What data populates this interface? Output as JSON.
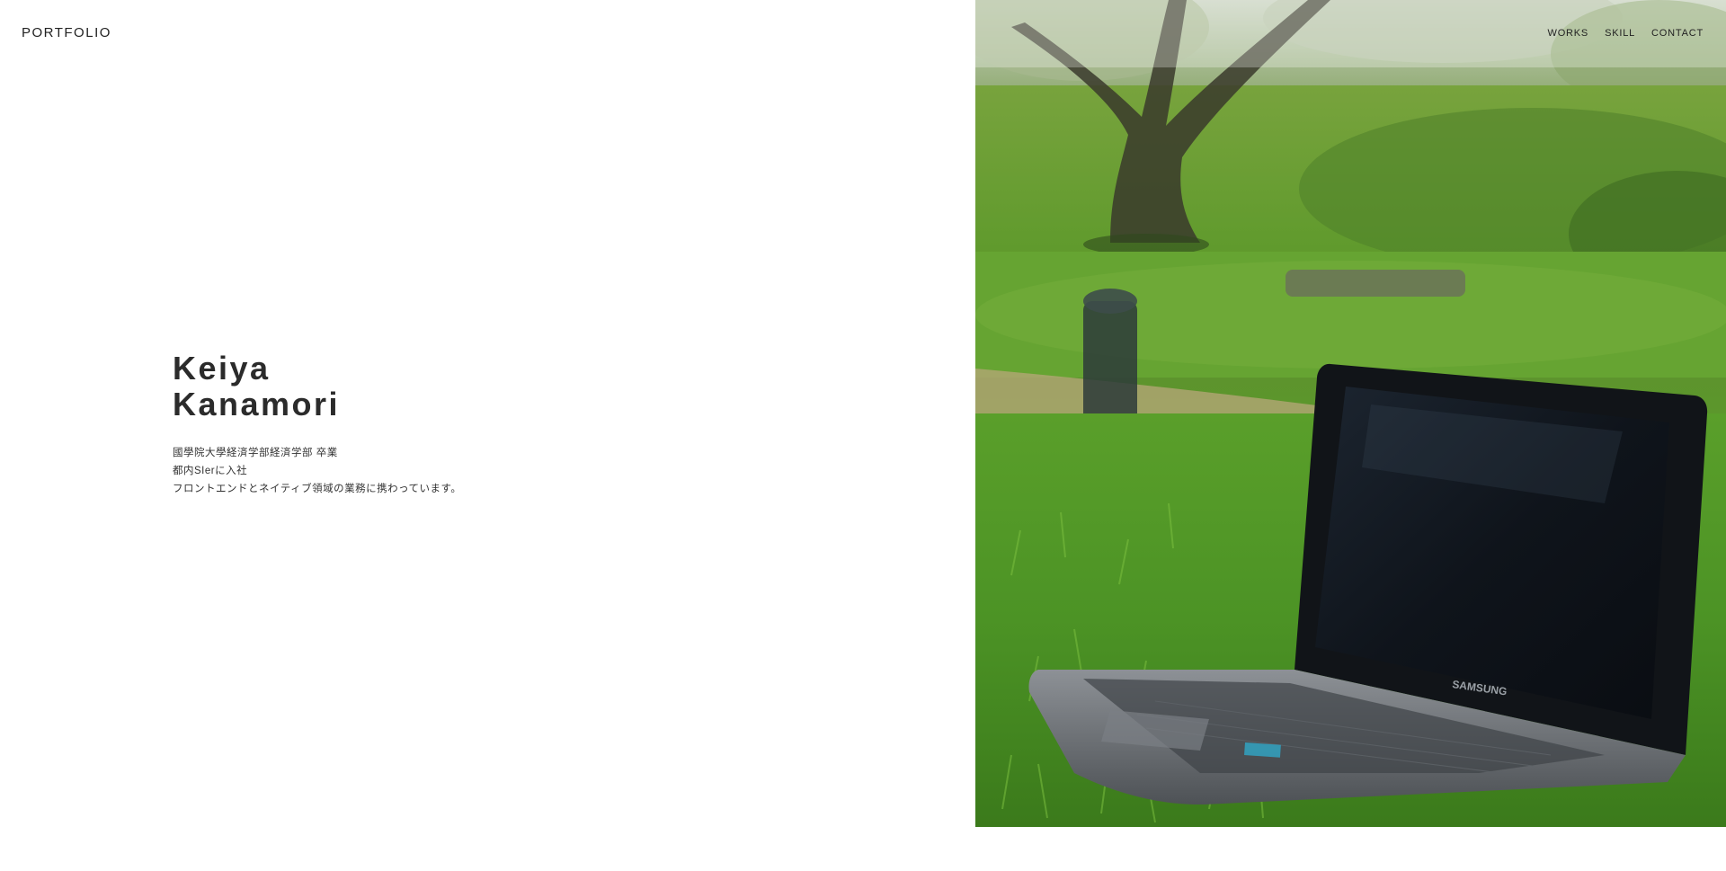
{
  "header": {
    "logo": "PORTFOLIO",
    "nav": [
      "WORKS",
      "SKILL",
      "CONTACT"
    ]
  },
  "profile": {
    "name_first": "Keiya",
    "name_last": "Kanamori",
    "bio": [
      "國學院大學経済学部経済学部 卒業",
      "都内SIerに入社",
      "フロントエンドとネイティブ領域の業務に携わっています。"
    ]
  },
  "hero": {
    "image": "laptop-on-grass-photo",
    "laptop_brand": "SAMSUNG"
  },
  "colors": {
    "text": "#333333",
    "background": "#ffffff",
    "grass": "#5a9b2b"
  }
}
